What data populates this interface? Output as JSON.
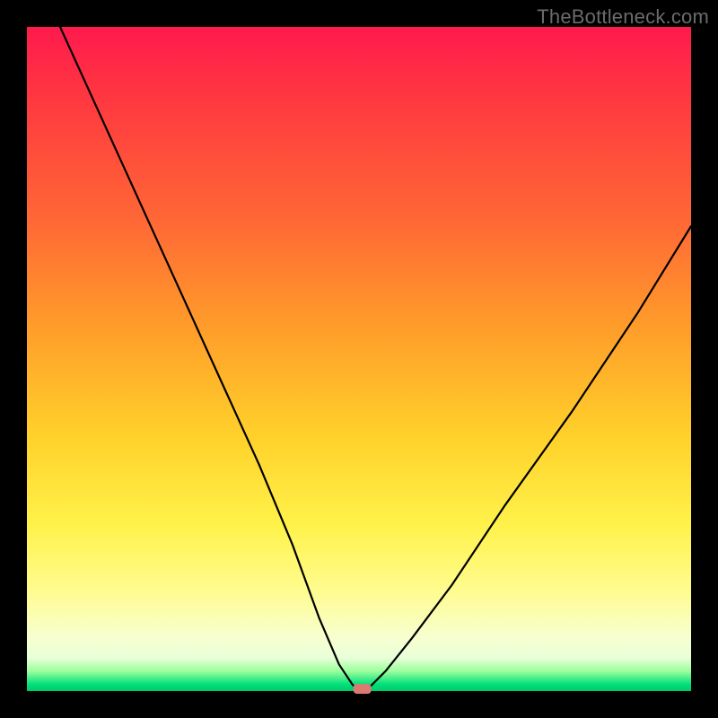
{
  "watermark": {
    "text": "TheBottleneck.com"
  },
  "chart_data": {
    "type": "line",
    "title": "",
    "xlabel": "",
    "ylabel": "",
    "xlim": [
      0,
      100
    ],
    "ylim": [
      0,
      100
    ],
    "grid": false,
    "legend": false,
    "series": [
      {
        "name": "bottleneck-curve",
        "x": [
          5,
          10,
          15,
          20,
          25,
          30,
          35,
          40,
          44,
          47,
          49,
          50,
          51,
          52,
          54,
          58,
          64,
          72,
          82,
          92,
          100
        ],
        "y": [
          100,
          89,
          78,
          67,
          56,
          45,
          34,
          22,
          11,
          4,
          1,
          0,
          0,
          1,
          3,
          8,
          16,
          28,
          42,
          57,
          70
        ]
      }
    ],
    "min_marker": {
      "x": 50.5,
      "y": 0
    },
    "background_gradient_stops": [
      {
        "pos": 0,
        "color": "#ff1a4d"
      },
      {
        "pos": 30,
        "color": "#ff6a35"
      },
      {
        "pos": 62,
        "color": "#ffd22a"
      },
      {
        "pos": 85,
        "color": "#fffc90"
      },
      {
        "pos": 97,
        "color": "#9cff9c"
      },
      {
        "pos": 100,
        "color": "#00c96a"
      }
    ]
  }
}
